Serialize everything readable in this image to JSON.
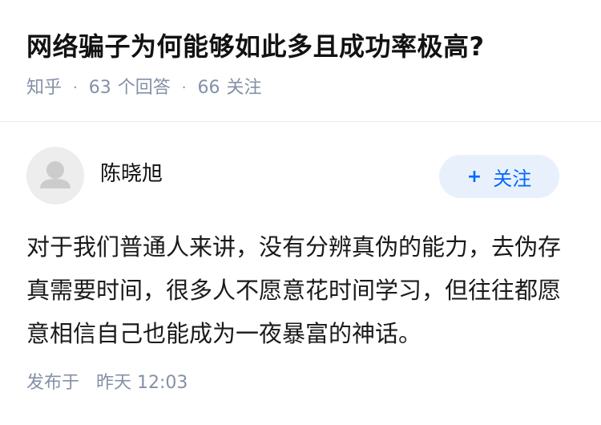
{
  "question": {
    "title": "网络骗子为何能够如此多且成功率极高?",
    "source": "知乎",
    "answer_count": "63",
    "answer_label": "个回答",
    "follower_count": "66",
    "follower_label": "关注"
  },
  "answer": {
    "author_name": "陈晓旭",
    "follow_label": "关注",
    "follow_icon": "plus-icon",
    "content": "对于我们普通人来讲，没有分辨真伪的能力，去伪存真需要时间，很多人不愿意花时间学习，但往往都愿意相信自己也能成为一夜暴富的神话。",
    "published_label": "发布于",
    "published_time": "昨天 12:03"
  },
  "colors": {
    "accent": "#0066ff",
    "follow_bg": "#e8f1fb",
    "meta_text": "#8590a6",
    "title_text": "#121212"
  }
}
